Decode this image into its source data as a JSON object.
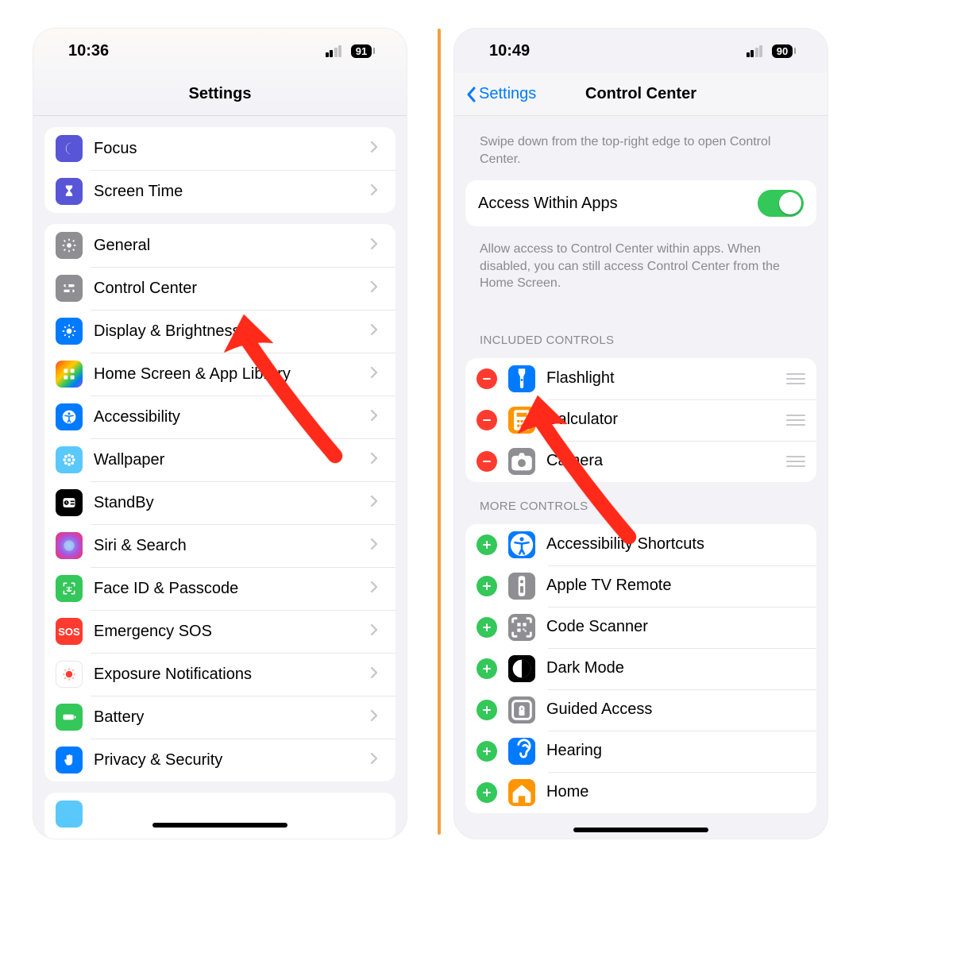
{
  "left": {
    "time": "10:36",
    "battery": "91",
    "title": "Settings",
    "group1": [
      {
        "label": "Focus",
        "color": "indigo",
        "icon": "moon"
      },
      {
        "label": "Screen Time",
        "color": "indigo",
        "icon": "hourglass"
      }
    ],
    "group2": [
      {
        "label": "General",
        "color": "gray",
        "icon": "gear"
      },
      {
        "label": "Control Center",
        "color": "gray",
        "icon": "sliders"
      },
      {
        "label": "Display & Brightness",
        "color": "blue",
        "icon": "sun"
      },
      {
        "label": "Home Screen & App Library",
        "color": "multi",
        "icon": "grid"
      },
      {
        "label": "Accessibility",
        "color": "blue",
        "icon": "a11y"
      },
      {
        "label": "Wallpaper",
        "color": "cyan",
        "icon": "flower"
      },
      {
        "label": "StandBy",
        "color": "blackbox",
        "icon": "clock"
      },
      {
        "label": "Siri & Search",
        "color": "siri",
        "icon": "siri"
      },
      {
        "label": "Face ID & Passcode",
        "color": "green",
        "icon": "faceid"
      },
      {
        "label": "Emergency SOS",
        "color": "red",
        "icon": "sos"
      },
      {
        "label": "Exposure Notifications",
        "color": "white",
        "icon": "exposure"
      },
      {
        "label": "Battery",
        "color": "green",
        "icon": "battery"
      },
      {
        "label": "Privacy & Security",
        "color": "blue",
        "icon": "hand"
      }
    ]
  },
  "right": {
    "time": "10:49",
    "battery": "90",
    "back": "Settings",
    "title": "Control Center",
    "intro": "Swipe down from the top-right edge to open Control Center.",
    "access_label": "Access Within Apps",
    "access_on": true,
    "access_desc": "Allow access to Control Center within apps. When disabled, you can still access Control Center from the Home Screen.",
    "included_header": "INCLUDED CONTROLS",
    "included": [
      {
        "label": "Flashlight",
        "color": "blue",
        "icon": "flashlight"
      },
      {
        "label": "Calculator",
        "color": "orange",
        "icon": "calc"
      },
      {
        "label": "Camera",
        "color": "gray",
        "icon": "camera"
      }
    ],
    "more_header": "MORE CONTROLS",
    "more": [
      {
        "label": "Accessibility Shortcuts",
        "color": "blue",
        "icon": "a11y"
      },
      {
        "label": "Apple TV Remote",
        "color": "gray",
        "icon": "remote"
      },
      {
        "label": "Code Scanner",
        "color": "gray",
        "icon": "qr"
      },
      {
        "label": "Dark Mode",
        "color": "blackbox",
        "icon": "dark"
      },
      {
        "label": "Guided Access",
        "color": "gray",
        "icon": "lock"
      },
      {
        "label": "Hearing",
        "color": "blue",
        "icon": "ear"
      },
      {
        "label": "Home",
        "color": "orange",
        "icon": "home"
      }
    ]
  }
}
